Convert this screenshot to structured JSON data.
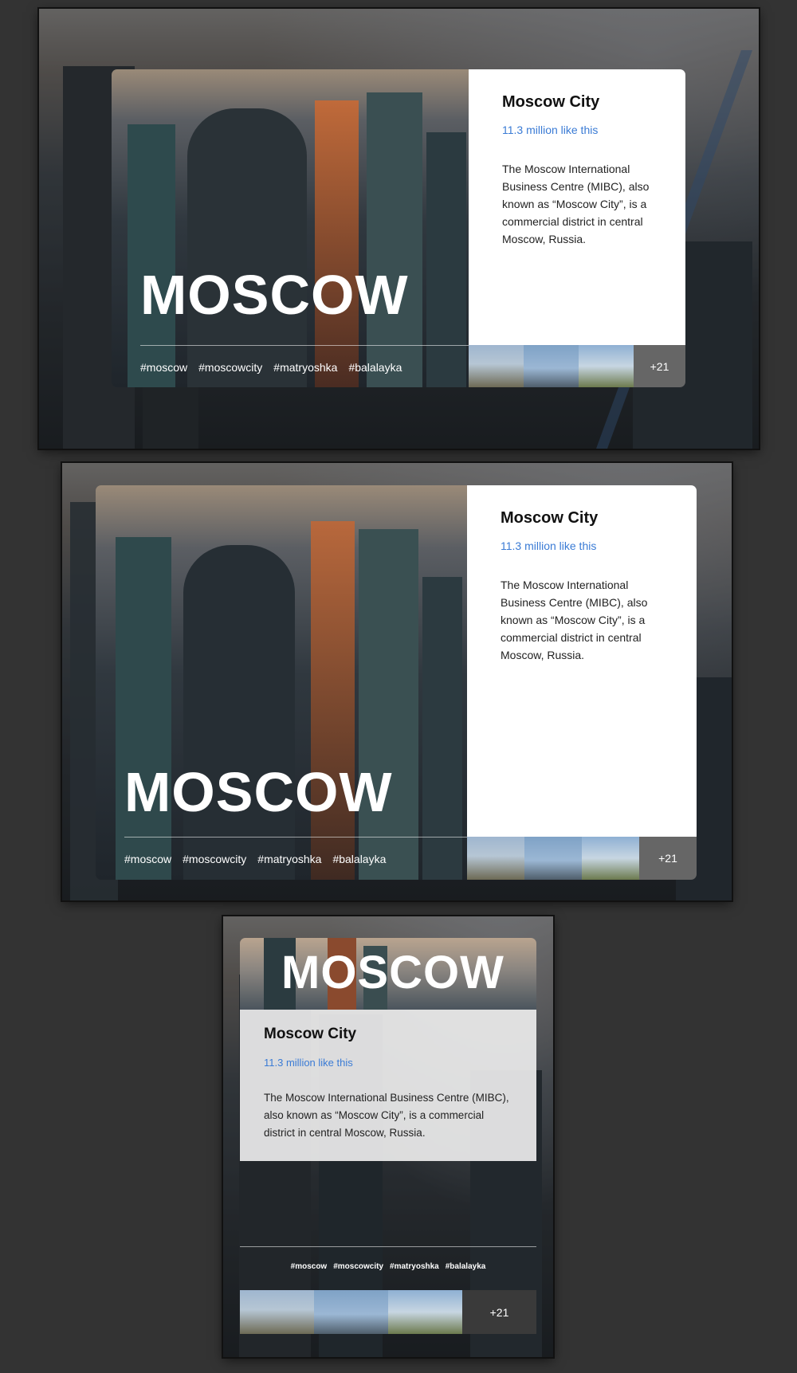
{
  "cards": [
    {
      "city": "MOSCOW",
      "title": "Moscow City",
      "likes": "11.3 million like this",
      "description": "The Moscow International Business Centre (MIBC), also known as “Moscow City”, is a commercial district in central Moscow, Russia.",
      "tags": [
        "#moscow",
        "#moscowcity",
        "#matryoshka",
        "#balalayka"
      ],
      "more_count": "+21",
      "thumbnails": [
        "basil-cathedral-thumbnail",
        "spasskaya-tower-thumbnail",
        "moscow-university-thumbnail"
      ]
    }
  ],
  "colors": {
    "likes": "#3a7bd5",
    "page_bg": "#333333",
    "more_bg": "#666666"
  }
}
